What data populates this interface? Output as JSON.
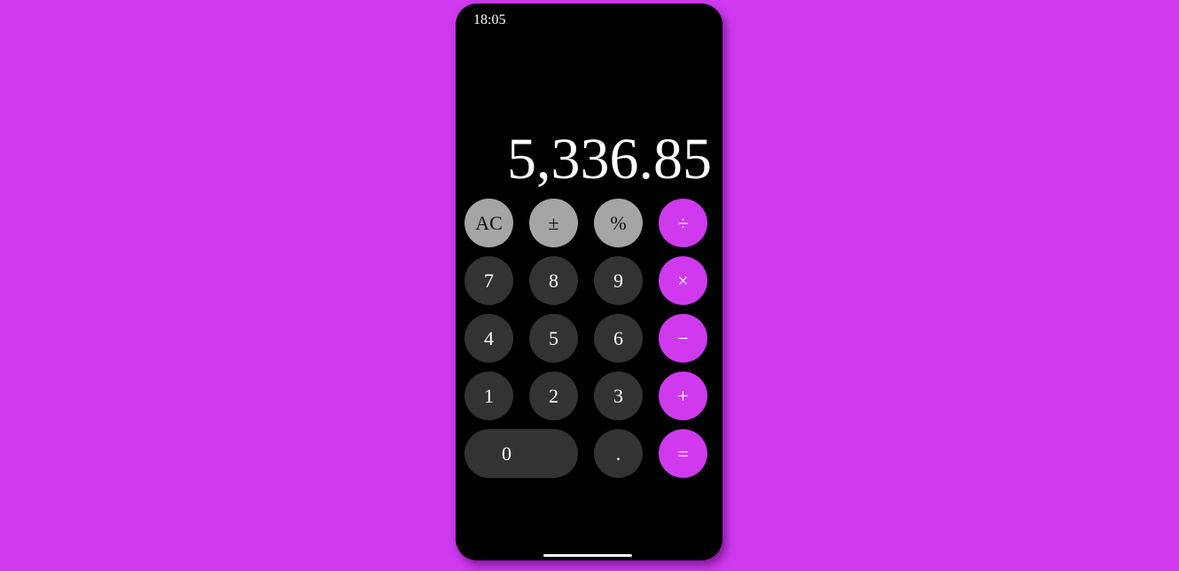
{
  "status_bar": {
    "time": "18:05"
  },
  "display": {
    "value": "5,336.85"
  },
  "keys": {
    "clear": "AC",
    "sign": "±",
    "percent": "%",
    "divide": "÷",
    "seven": "7",
    "eight": "8",
    "nine": "9",
    "multiply": "×",
    "four": "4",
    "five": "5",
    "six": "6",
    "subtract": "−",
    "one": "1",
    "two": "2",
    "three": "3",
    "add": "+",
    "zero": "0",
    "decimal": ".",
    "equals": "="
  },
  "colors": {
    "background": "#cf3aef",
    "function_key": "#a5a5a5",
    "number_key": "#333333",
    "operator_key": "#cf3aef"
  }
}
